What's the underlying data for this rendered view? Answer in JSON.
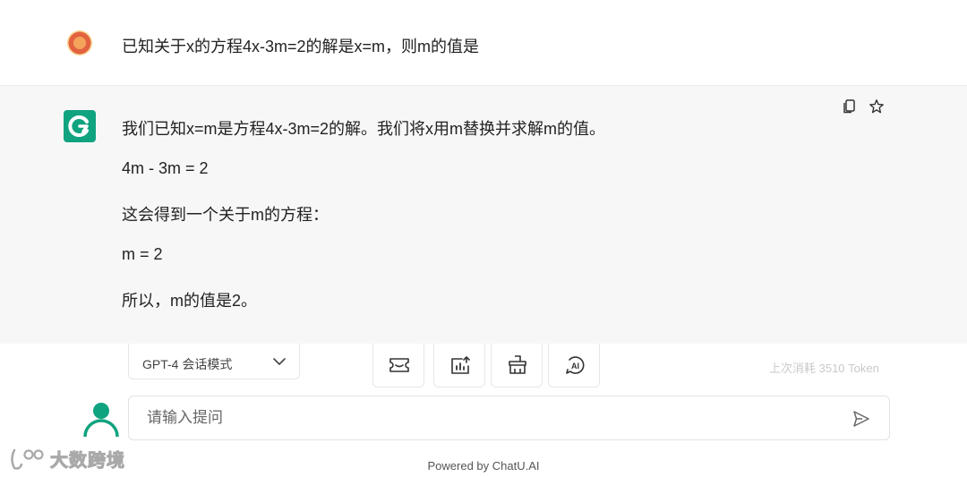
{
  "user_message": {
    "text": "已知关于x的方程4x-3m=2的解是x=m，则m的值是"
  },
  "bot_message": {
    "lines": [
      "我们已知x=m是方程4x-3m=2的解。我们将x用m替换并求解m的值。",
      "4m - 3m = 2",
      "这会得到一个关于m的方程：",
      "m = 2",
      "所以，m的值是2。"
    ]
  },
  "controls": {
    "model_select": "GPT-4 会话模式",
    "token_info": "上次消耗 3510 Token"
  },
  "input": {
    "placeholder": "请输入提问"
  },
  "footer": {
    "powered": "Powered by ChatU.AI"
  },
  "watermark": {
    "text": "大数跨境"
  },
  "colors": {
    "brand": "#10a37f",
    "bot_bg": "#f7f7f8"
  }
}
